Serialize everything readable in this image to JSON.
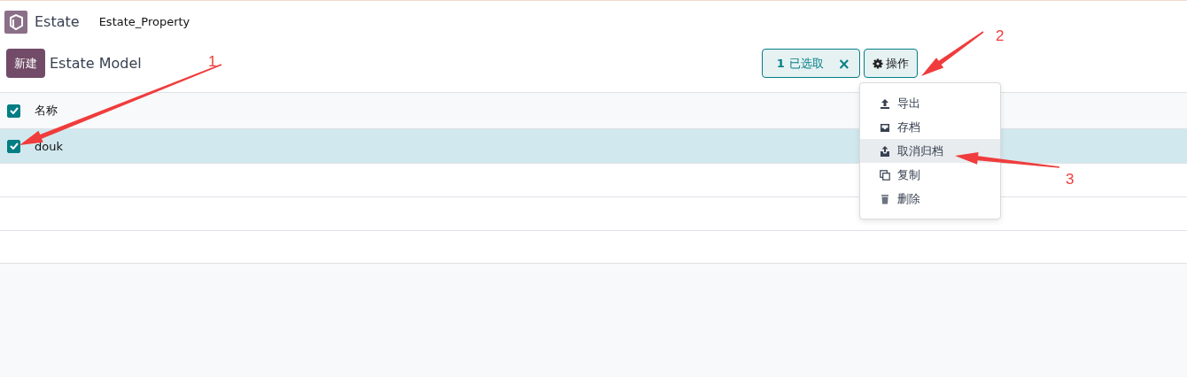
{
  "app": {
    "name": "Estate",
    "breadcrumb": "Estate_Property"
  },
  "control_panel": {
    "new_button": "新建",
    "title": "Estate Model",
    "selection": {
      "count": "1",
      "label": "已选取",
      "clear": "×"
    },
    "actions_button": "操作"
  },
  "table": {
    "header": {
      "checked": true,
      "column": "名称"
    },
    "rows": [
      {
        "name": "douk",
        "checked": true,
        "selected": true
      }
    ]
  },
  "actions_menu": [
    {
      "kind": "export",
      "label": "导出",
      "selected": false
    },
    {
      "kind": "archive",
      "label": "存档",
      "selected": false
    },
    {
      "kind": "unarchive",
      "label": "取消归档",
      "selected": true
    },
    {
      "kind": "duplicate",
      "label": "复制",
      "selected": false
    },
    {
      "kind": "delete",
      "label": "删除",
      "selected": false
    }
  ],
  "annotations": [
    {
      "label": "1",
      "kind": "checkbox"
    },
    {
      "label": "2",
      "kind": "actions"
    },
    {
      "label": "3",
      "kind": "menuitem"
    }
  ]
}
